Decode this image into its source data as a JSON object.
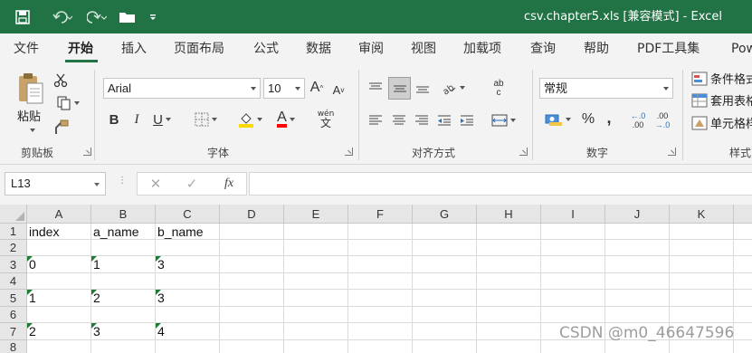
{
  "title_bar": {
    "window_title": "csv.chapter5.xls  [兼容模式]  -  Excel",
    "qat_icons": [
      "save-icon",
      "undo-icon",
      "redo-icon",
      "open-folder-icon",
      "customize-qat-icon"
    ]
  },
  "tabs": [
    "文件",
    "开始",
    "插入",
    "页面布局",
    "公式",
    "数据",
    "审阅",
    "视图",
    "加载项",
    "查询",
    "帮助",
    "PDF工具集",
    "Pow"
  ],
  "active_tab": "开始",
  "ribbon": {
    "clipboard": {
      "paste_label": "粘贴",
      "group_label": "剪贴板"
    },
    "font": {
      "font_name": "Arial",
      "font_size": "10",
      "bold": "B",
      "italic": "I",
      "underline": "U",
      "grow": "A",
      "shrink": "A",
      "font_color_glyph": "A",
      "phonetic_top": "wén",
      "phonetic_bottom": "文",
      "group_label": "字体",
      "font_color": "#ff0000",
      "fill_color": "#ffd800"
    },
    "alignment": {
      "group_label": "对齐方式",
      "wrap_top": "ab",
      "wrap_bottom": "c"
    },
    "number": {
      "format": "常规",
      "percent": "%",
      "comma": ",",
      "inc_decimal_top": "←.0",
      "inc_decimal_bottom": ".00",
      "dec_decimal_top": ".00",
      "dec_decimal_bottom": "→.0",
      "group_label": "数字"
    },
    "styles": {
      "conditional": "条件格式",
      "table": "套用表格",
      "cell_styles": "单元格样",
      "group_label": "样式"
    }
  },
  "formula_bar": {
    "name_box": "L13",
    "cancel": "✕",
    "enter": "✓",
    "fx": "fx",
    "value": ""
  },
  "columns": [
    "A",
    "B",
    "C",
    "D",
    "E",
    "F",
    "G",
    "H",
    "I",
    "J",
    "K"
  ],
  "rows": [
    "1",
    "2",
    "3",
    "4",
    "5",
    "6",
    "7",
    "8"
  ],
  "cells": {
    "A1": "index",
    "B1": "a_name",
    "C1": "b_name",
    "A3": "0",
    "B3": "1",
    "C3": "3",
    "A5": "1",
    "B5": "2",
    "C5": "3",
    "A7": "2",
    "B7": "3",
    "C7": "4"
  },
  "watermark": "CSDN @m0_46647596",
  "accent_color": "#217346"
}
